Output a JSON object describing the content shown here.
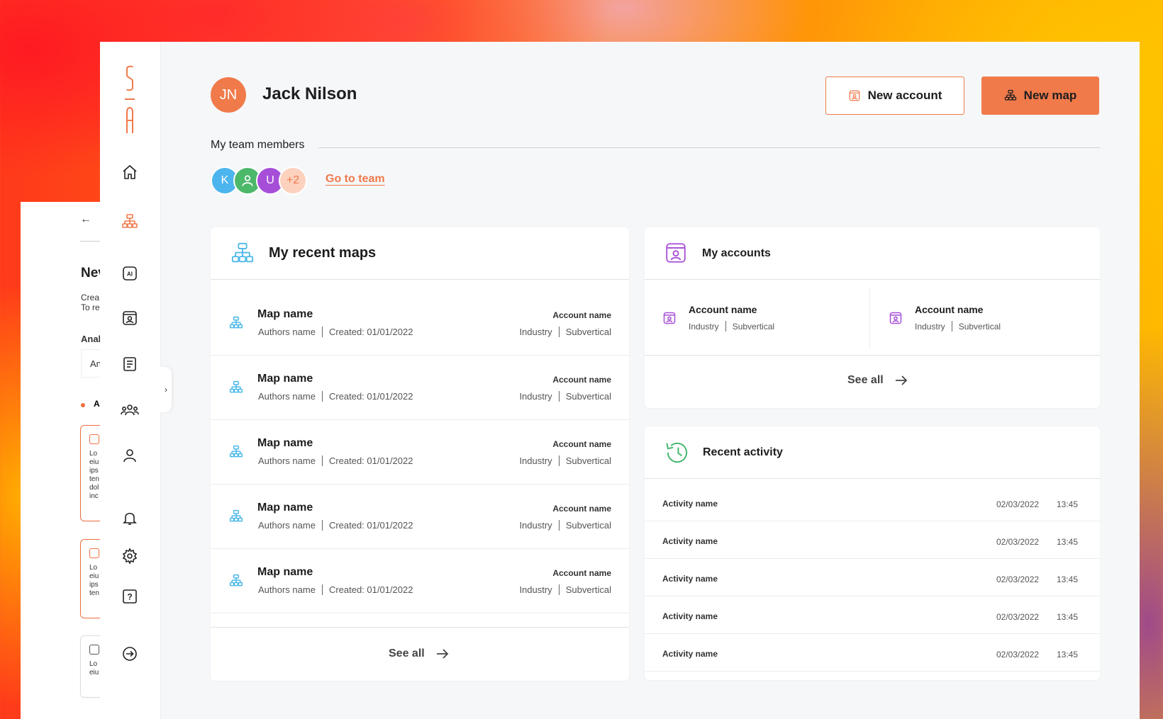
{
  "background_panel": {
    "heading": "Nev",
    "line1": "Crea",
    "line2": "To re",
    "section": "Anal",
    "input_value": "An",
    "item_label": "A",
    "card_lines": [
      "Lo",
      "eiu",
      "ips",
      "ten",
      "dol",
      "inc"
    ],
    "card2_lines": [
      "Lo",
      "eiu",
      "ips",
      "ten"
    ],
    "card3_lines": [
      "Lo",
      "eiu"
    ]
  },
  "sidebar": {
    "items": [
      {
        "name": "home",
        "icon": "home-icon"
      },
      {
        "name": "maps",
        "icon": "sitemap-icon",
        "active": true
      },
      {
        "name": "ai",
        "icon": "ai-icon",
        "label": "AI"
      },
      {
        "name": "accounts",
        "icon": "account-card-icon"
      },
      {
        "name": "documents",
        "icon": "document-icon"
      },
      {
        "name": "team",
        "icon": "team-icon"
      },
      {
        "name": "profile",
        "icon": "user-icon"
      },
      {
        "name": "notifications",
        "icon": "bell-icon"
      },
      {
        "name": "settings",
        "icon": "gear-icon"
      },
      {
        "name": "help",
        "icon": "help-icon",
        "label": "?"
      },
      {
        "name": "logout",
        "icon": "logout-icon"
      }
    ],
    "collapse_glyph": "›"
  },
  "colors": {
    "accent": "#f07a4a",
    "maps_icon": "#4db8e8",
    "accounts_icon": "#a64ed8",
    "activity_icon": "#3fb46a"
  },
  "header": {
    "initials": "JN",
    "user_name": "Jack Nilson",
    "new_account_label": "New account",
    "new_map_label": "New map"
  },
  "team": {
    "label": "My team members",
    "members": [
      {
        "initial": "K",
        "color": "#4cb5ee"
      },
      {
        "initial": "",
        "color": "#4cb86a",
        "icon": "user-icon"
      },
      {
        "initial": "U",
        "color": "#a64ed8"
      },
      {
        "initial": "+2",
        "color": "#fcd1be",
        "text_color": "#f07a4a"
      }
    ],
    "go_to_team": "Go to team"
  },
  "recent_maps": {
    "title": "My recent maps",
    "see_all": "See all",
    "rows": [
      {
        "name": "Map name",
        "author": "Authors name",
        "created": "Created: 01/01/2022",
        "account": "Account name",
        "industry": "Industry",
        "subvertical": "Subvertical"
      },
      {
        "name": "Map name",
        "author": "Authors name",
        "created": "Created: 01/01/2022",
        "account": "Account name",
        "industry": "Industry",
        "subvertical": "Subvertical"
      },
      {
        "name": "Map name",
        "author": "Authors name",
        "created": "Created: 01/01/2022",
        "account": "Account name",
        "industry": "Industry",
        "subvertical": "Subvertical"
      },
      {
        "name": "Map name",
        "author": "Authors name",
        "created": "Created: 01/01/2022",
        "account": "Account name",
        "industry": "Industry",
        "subvertical": "Subvertical"
      },
      {
        "name": "Map name",
        "author": "Authors name",
        "created": "Created: 01/01/2022",
        "account": "Account name",
        "industry": "Industry",
        "subvertical": "Subvertical"
      }
    ]
  },
  "accounts": {
    "title": "My accounts",
    "see_all": "See all",
    "items": [
      {
        "name": "Account name",
        "industry": "Industry",
        "subvertical": "Subvertical"
      },
      {
        "name": "Account name",
        "industry": "Industry",
        "subvertical": "Subvertical"
      }
    ]
  },
  "activity": {
    "title": "Recent activity",
    "rows": [
      {
        "name": "Activity name",
        "date": "02/03/2022",
        "time": "13:45"
      },
      {
        "name": "Activity name",
        "date": "02/03/2022",
        "time": "13:45"
      },
      {
        "name": "Activity name",
        "date": "02/03/2022",
        "time": "13:45"
      },
      {
        "name": "Activity name",
        "date": "02/03/2022",
        "time": "13:45"
      },
      {
        "name": "Activity name",
        "date": "02/03/2022",
        "time": "13:45"
      }
    ]
  }
}
